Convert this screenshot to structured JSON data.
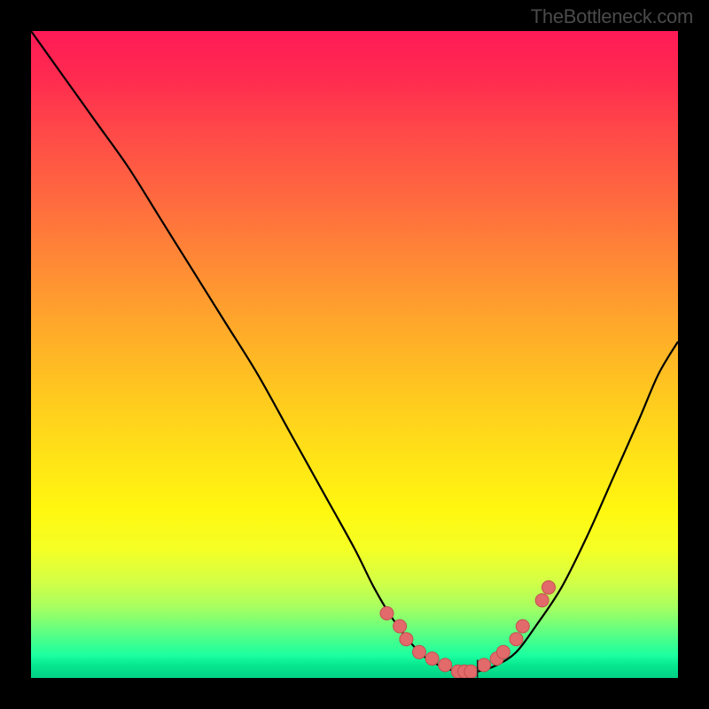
{
  "attribution": "TheBottleneck.com",
  "chart_data": {
    "type": "line",
    "title": "",
    "xlabel": "",
    "ylabel": "",
    "x_range": [
      0,
      100
    ],
    "y_range": [
      0,
      100
    ],
    "series": [
      {
        "name": "bottleneck-curve",
        "x": [
          0,
          5,
          10,
          15,
          20,
          25,
          30,
          35,
          40,
          45,
          50,
          53,
          56,
          60,
          63,
          66,
          69,
          72,
          75,
          78,
          82,
          86,
          90,
          94,
          97,
          100
        ],
        "y": [
          100,
          93,
          86,
          79,
          71,
          63,
          55,
          47,
          38,
          29,
          20,
          14,
          9,
          4,
          2,
          1,
          1,
          2,
          4,
          8,
          14,
          22,
          31,
          40,
          47,
          52
        ]
      }
    ],
    "markers": {
      "name": "highlighted-points",
      "x": [
        55,
        57,
        58,
        60,
        62,
        64,
        66,
        67,
        68,
        70,
        72,
        73,
        75,
        76,
        79,
        80
      ],
      "y": [
        10,
        8,
        6,
        4,
        3,
        2,
        1,
        1,
        1,
        2,
        3,
        4,
        6,
        8,
        12,
        14
      ]
    },
    "axis_tick": {
      "x": 69,
      "y_from": 0,
      "y_to": 2
    }
  }
}
